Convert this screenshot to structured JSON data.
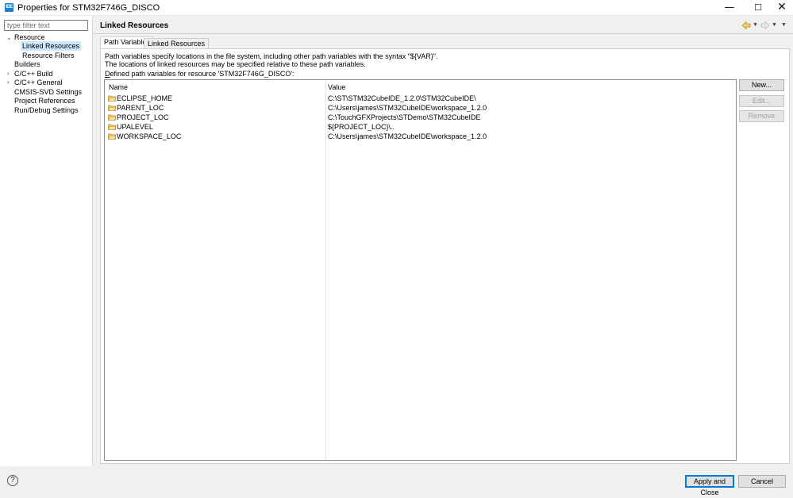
{
  "window": {
    "icon_text": "IDE",
    "title": "Properties for STM32F746G_DISCO",
    "minimize": "—",
    "maximize": "☐",
    "close": "✕"
  },
  "tree": {
    "filter_placeholder": "type filter text",
    "items": [
      {
        "label": "Resource",
        "expanded": true
      },
      {
        "label": "Linked Resources",
        "selected": true
      },
      {
        "label": "Resource Filters"
      },
      {
        "label": "Builders"
      },
      {
        "label": "C/C++ Build",
        "expandable": true
      },
      {
        "label": "C/C++ General",
        "expandable": true
      },
      {
        "label": "CMSIS-SVD Settings"
      },
      {
        "label": "Project References"
      },
      {
        "label": "Run/Debug Settings"
      }
    ]
  },
  "page": {
    "title": "Linked Resources",
    "nav_back_icon": "back-arrow-icon",
    "nav_forward_icon": "forward-arrow-icon",
    "menu_icon": "view-menu-icon"
  },
  "tabs": [
    {
      "label": "Path Variables",
      "active": true
    },
    {
      "label": "Linked Resources",
      "active": false
    }
  ],
  "description": {
    "line1": "Path variables specify locations in the file system, including other path variables with the syntax \"${VAR}\".",
    "line2": "The locations of linked resources may be specified relative to these path variables.",
    "defined_prefix": "D",
    "defined_rest": "efined path variables for resource 'STM32F746G_DISCO':"
  },
  "table": {
    "columns": [
      "Name",
      "Value"
    ],
    "rows": [
      {
        "name": "ECLIPSE_HOME",
        "value": "C:\\ST\\STM32CubeIDE_1.2.0\\STM32CubeIDE\\"
      },
      {
        "name": "PARENT_LOC",
        "value": "C:\\Users\\james\\STM32CubeIDE\\workspace_1.2.0"
      },
      {
        "name": "PROJECT_LOC",
        "value": "C:\\TouchGFXProjects\\STDemo\\STM32CubeIDE"
      },
      {
        "name": "UPALEVEL",
        "value": "${PROJECT_LOC}\\.."
      },
      {
        "name": "WORKSPACE_LOC",
        "value": "C:\\Users\\james\\STM32CubeIDE\\workspace_1.2.0"
      }
    ]
  },
  "side_buttons": {
    "new": "New...",
    "edit": "Edit...",
    "remove": "Remove"
  },
  "bottom": {
    "help": "?",
    "apply_close": "Apply and Close",
    "cancel": "Cancel"
  },
  "colors": {
    "selection": "#cce8ff",
    "folder": "#e8b64c",
    "default_button_border": "#0078d7",
    "app_icon": "#1d7fd0"
  }
}
